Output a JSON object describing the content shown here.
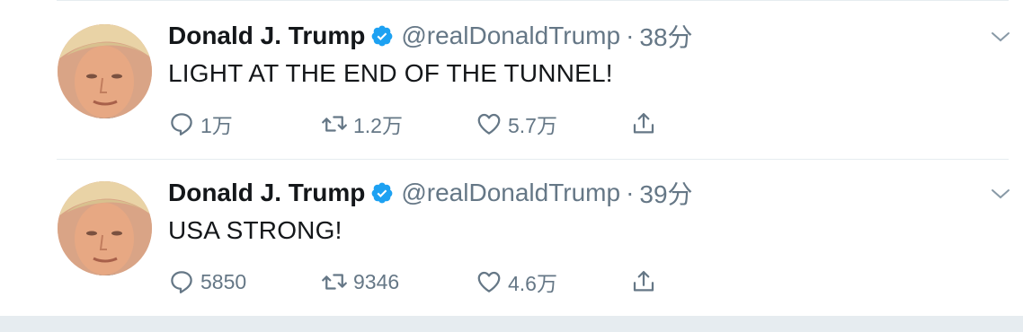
{
  "tweets": [
    {
      "author": "Donald J. Trump",
      "handle": "@realDonaldTrump",
      "separator": "·",
      "time": "38分",
      "text": "LIGHT AT THE END OF THE TUNNEL!",
      "replies": "1万",
      "retweets": "1.2万",
      "likes": "5.7万"
    },
    {
      "author": "Donald J. Trump",
      "handle": "@realDonaldTrump",
      "separator": "·",
      "time": "39分",
      "text": "USA STRONG!",
      "replies": "5850",
      "retweets": "9346",
      "likes": "4.6万"
    }
  ],
  "icons": {
    "verified": "verified-badge-icon",
    "reply": "reply-icon",
    "retweet": "retweet-icon",
    "like": "heart-icon",
    "share": "share-icon",
    "menu": "chevron-down-icon"
  },
  "colors": {
    "verified_blue": "#1da1f2",
    "secondary_text": "#657786",
    "primary_text": "#14171a",
    "border": "#e6ecf0"
  }
}
